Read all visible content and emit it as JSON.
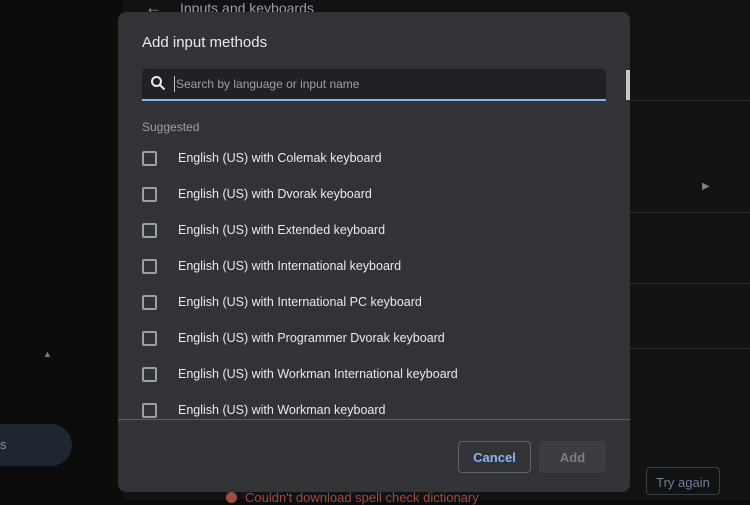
{
  "background": {
    "title": "Inputs and keyboards",
    "sidebar_pill": "s",
    "try_again": "Try again",
    "error": "Couldn't download spell check dictionary"
  },
  "dialog": {
    "title": "Add input methods",
    "search": {
      "placeholder": "Search by language or input name",
      "value": ""
    },
    "section_label": "Suggested",
    "items": [
      {
        "label": "English (US) with Colemak keyboard",
        "checked": false
      },
      {
        "label": "English (US) with Dvorak keyboard",
        "checked": false
      },
      {
        "label": "English (US) with Extended keyboard",
        "checked": false
      },
      {
        "label": "English (US) with International keyboard",
        "checked": false
      },
      {
        "label": "English (US) with International PC keyboard",
        "checked": false
      },
      {
        "label": "English (US) with Programmer Dvorak keyboard",
        "checked": false
      },
      {
        "label": "English (US) with Workman International keyboard",
        "checked": false
      },
      {
        "label": "English (US) with Workman keyboard",
        "checked": false
      }
    ],
    "cancel": "Cancel",
    "add": "Add"
  },
  "colors": {
    "accent": "#8ab4f8",
    "dialog_bg": "#323336",
    "error": "#a04b44"
  }
}
